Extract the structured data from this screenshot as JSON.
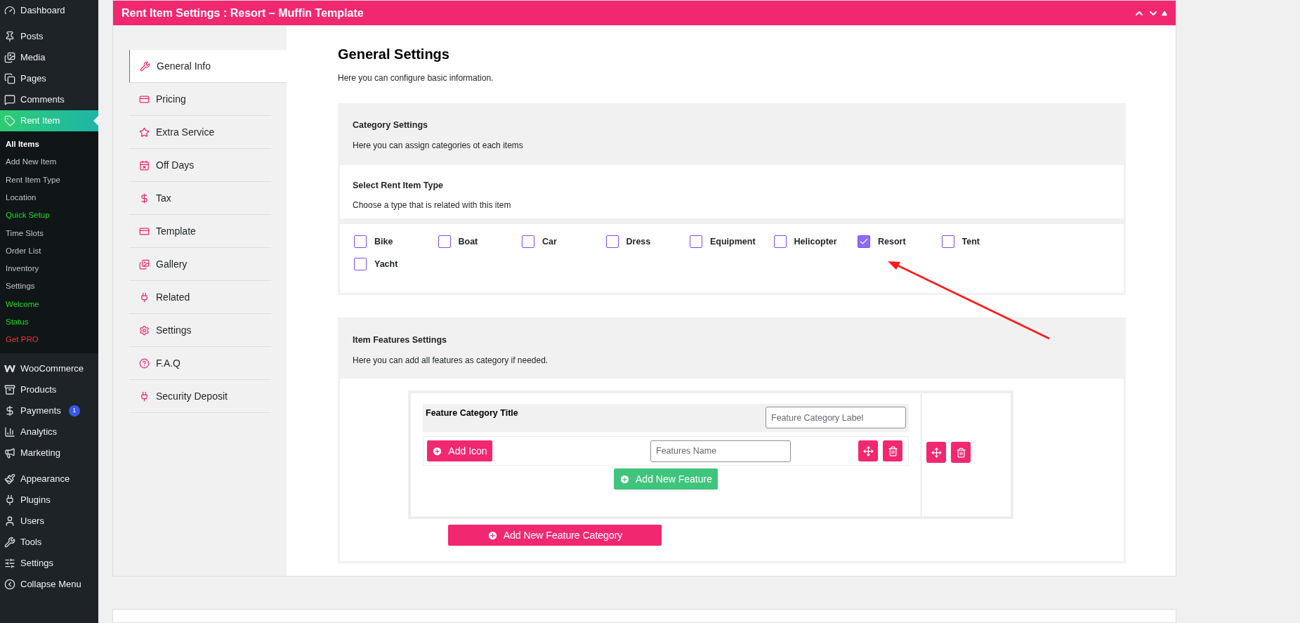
{
  "admin_menu": {
    "items": [
      {
        "label": "Dashboard",
        "selected": false
      },
      {
        "label": "Posts",
        "selected": false
      },
      {
        "label": "Media",
        "selected": false
      },
      {
        "label": "Pages",
        "selected": false
      },
      {
        "label": "Comments",
        "selected": false
      },
      {
        "label": "Rent Item",
        "selected": true,
        "submenu": [
          {
            "label": "All Items",
            "selected": true
          },
          {
            "label": "Add New Item",
            "selected": false
          },
          {
            "label": "Rent Item Type",
            "selected": false
          },
          {
            "label": "Location",
            "selected": false
          },
          {
            "label": "Quick Setup",
            "selected": false,
            "color": "#22dd22"
          },
          {
            "label": "Time Slots",
            "selected": false
          },
          {
            "label": "Order List",
            "selected": false
          },
          {
            "label": "Inventory",
            "selected": false
          },
          {
            "label": "Settings",
            "selected": false
          },
          {
            "label": "Welcome",
            "selected": false,
            "color": "#22dd22"
          },
          {
            "label": "Status",
            "selected": false,
            "color": "#22dd22"
          },
          {
            "label": "Get PRO",
            "selected": false,
            "color": "#e53935"
          }
        ]
      },
      {
        "label": "WooCommerce",
        "selected": false
      },
      {
        "label": "Products",
        "selected": false
      },
      {
        "label": "Payments",
        "selected": false,
        "badge": "1"
      },
      {
        "label": "Analytics",
        "selected": false
      },
      {
        "label": "Marketing",
        "selected": false
      },
      {
        "label": "Appearance",
        "selected": false
      },
      {
        "label": "Plugins",
        "selected": false
      },
      {
        "label": "Users",
        "selected": false
      },
      {
        "label": "Tools",
        "selected": false
      },
      {
        "label": "Settings",
        "selected": false
      },
      {
        "label": "Collapse Menu",
        "selected": false
      }
    ]
  },
  "panel": {
    "title": "Rent Item Settings : Resort – Muffin Template",
    "tabs": [
      {
        "label": "General Info",
        "selected": true
      },
      {
        "label": "Pricing",
        "selected": false
      },
      {
        "label": "Extra Service",
        "selected": false
      },
      {
        "label": "Off Days",
        "selected": false
      },
      {
        "label": "Tax",
        "selected": false
      },
      {
        "label": "Template",
        "selected": false
      },
      {
        "label": "Gallery",
        "selected": false
      },
      {
        "label": "Related",
        "selected": false
      },
      {
        "label": "Settings",
        "selected": false
      },
      {
        "label": "F.A.Q",
        "selected": false
      },
      {
        "label": "Security Deposit",
        "selected": false
      }
    ],
    "heading": "General Settings",
    "description": "Here you can configure basic information.",
    "category_settings": {
      "title": "Category Settings",
      "description": "Here you can assign categories ot each items",
      "type_title": "Select Rent Item Type",
      "type_description": "Choose a type that is related with this item",
      "types": [
        {
          "label": "Bike",
          "checked": false
        },
        {
          "label": "Boat",
          "checked": false
        },
        {
          "label": "Car",
          "checked": false
        },
        {
          "label": "Dress",
          "checked": false
        },
        {
          "label": "Equipment",
          "checked": false
        },
        {
          "label": "Helicopter",
          "checked": false
        },
        {
          "label": "Resort",
          "checked": true
        },
        {
          "label": "Tent",
          "checked": false
        },
        {
          "label": "Yacht",
          "checked": false
        }
      ]
    },
    "features": {
      "title": "Item Features Settings",
      "description": "Here you can add all features as category if needed.",
      "category_title": "Feature Category Title",
      "category_placeholder": "Feature Category Label",
      "add_icon": "Add Icon",
      "feature_placeholder": "Features Name",
      "add_feature": "Add New Feature",
      "add_category": "Add New Feature Category"
    }
  }
}
